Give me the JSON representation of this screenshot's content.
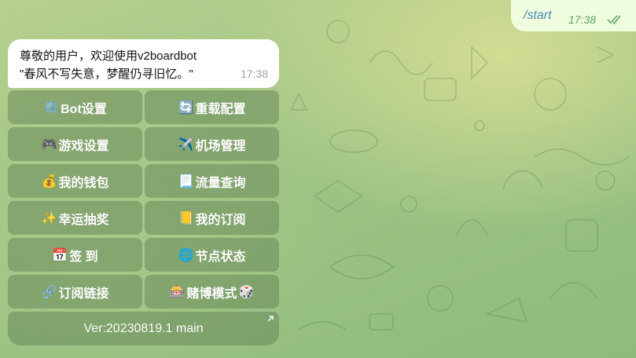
{
  "colors": {
    "outgoing_bubble": "#effdde",
    "incoming_bubble": "#ffffff",
    "button_bg": "rgba(88,120,76,0.42)",
    "outgoing_text": "#4a8ab8",
    "outgoing_time": "#5fa06b"
  },
  "outgoing": {
    "text": "/start",
    "time": "17:38",
    "status_icon": "double-check-icon"
  },
  "incoming": {
    "line1": "尊敬的用户，欢迎使用v2boardbot",
    "line2": "\"春风不写失意，梦醒仍寻旧忆。\"",
    "time": "17:38"
  },
  "keyboard": {
    "rows": [
      [
        {
          "emoji": "⚙️",
          "label": "Bot设置"
        },
        {
          "emoji": "🔄",
          "label": "重载配置"
        }
      ],
      [
        {
          "emoji": "🎮",
          "label": "游戏设置"
        },
        {
          "emoji": "✈️",
          "label": "机场管理"
        }
      ],
      [
        {
          "emoji": "💰",
          "label": "我的钱包"
        },
        {
          "emoji": "📃",
          "label": "流量查询"
        }
      ],
      [
        {
          "emoji": "✨",
          "label": "幸运抽奖"
        },
        {
          "emoji": "📒",
          "label": "我的订阅"
        }
      ],
      [
        {
          "emoji": "📅",
          "label": "签 到"
        },
        {
          "emoji": "🌐",
          "label": "节点状态"
        }
      ],
      [
        {
          "emoji": "🔗",
          "label": "订阅链接"
        },
        {
          "emoji": "🎰",
          "label": "赌博模式",
          "emoji_after": "🎲"
        }
      ]
    ],
    "footer": {
      "label": "Ver:20230819.1 main",
      "icon": "external-link-arrow-icon"
    }
  }
}
